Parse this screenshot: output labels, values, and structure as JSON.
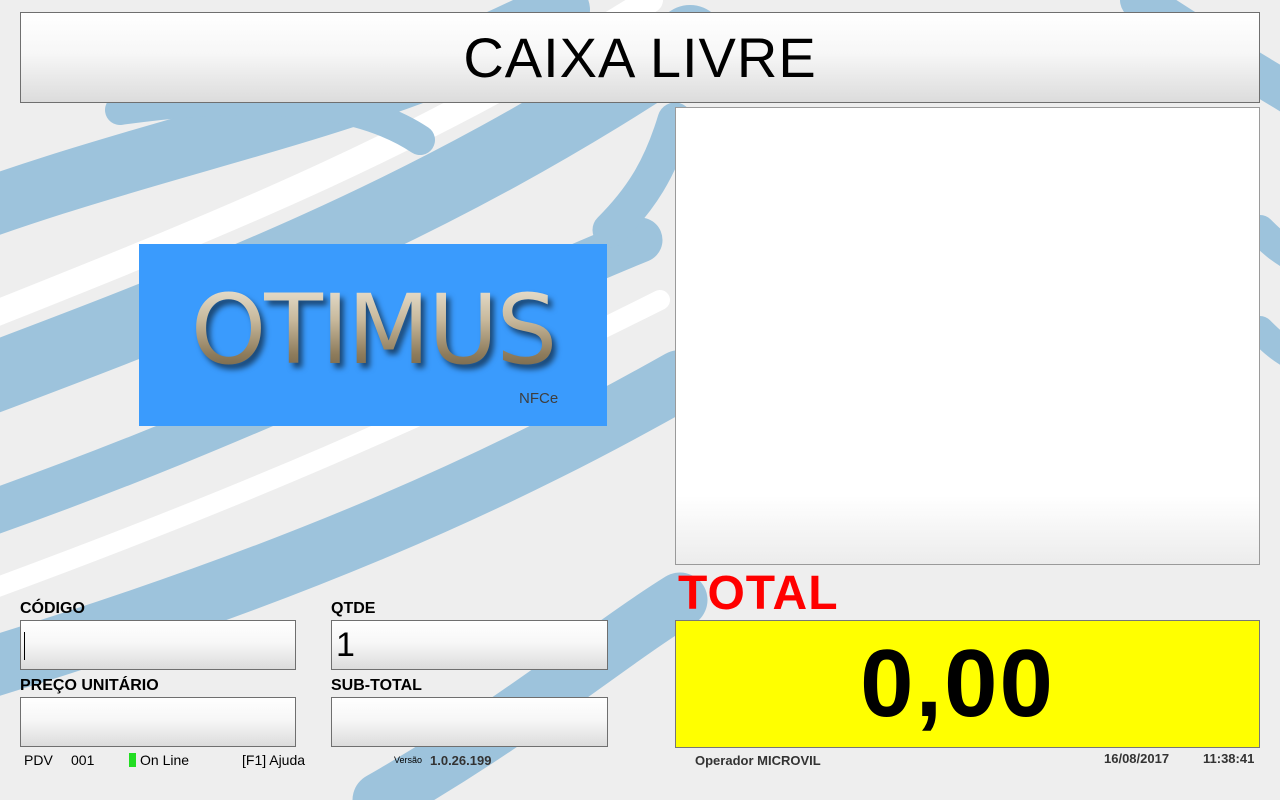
{
  "header": {
    "status_title": "CAIXA LIVRE"
  },
  "logo": {
    "brand": "OTIMUS",
    "subtitle": "NFCe"
  },
  "fields": {
    "codigo": {
      "label": "CÓDIGO",
      "value": ""
    },
    "qtde": {
      "label": "QTDE",
      "value": "1"
    },
    "preco_unitario": {
      "label": "PREÇO UNITÁRIO",
      "value": ""
    },
    "sub_total": {
      "label": "SUB-TOTAL",
      "value": ""
    }
  },
  "total": {
    "label": "TOTAL",
    "value": "0,00"
  },
  "status_bar": {
    "pdv_label": "PDV",
    "pdv_number": "001",
    "connection": "On Line",
    "help_hint": "[F1] Ajuda",
    "version_label": "Versão",
    "version": "1.0.26.199",
    "operator": "Operador MICROVIL",
    "date": "16/08/2017",
    "time": "11:38:41"
  },
  "colors": {
    "total_bg": "#ffff00",
    "total_label": "#ff0000",
    "logo_bg": "#3a9bfd",
    "online_indicator": "#22dd22",
    "background_stripes": "#9dc3dc"
  }
}
